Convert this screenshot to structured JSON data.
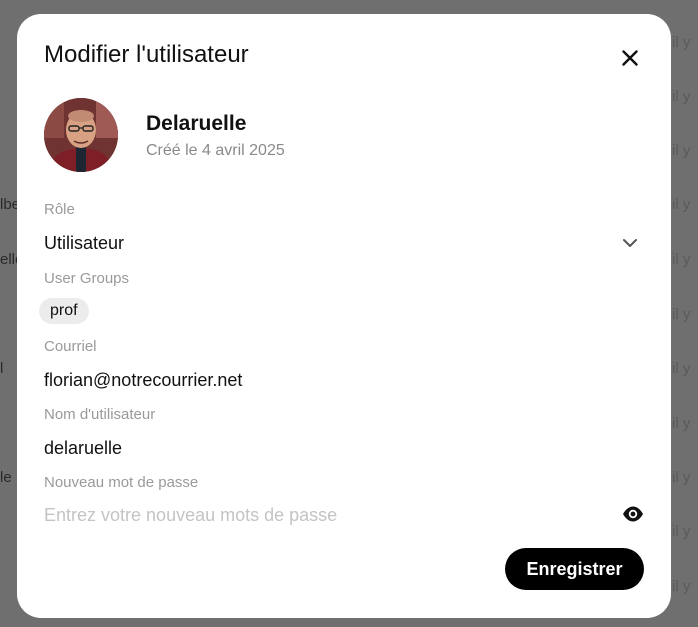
{
  "background": {
    "left_texts": [
      "lbe",
      "elle",
      "l",
      "le"
    ],
    "right_text": "il y"
  },
  "modal": {
    "title": "Modifier l'utilisateur",
    "close_icon": "close-icon",
    "user": {
      "name": "Delaruelle",
      "created": "Créé le 4 avril 2025"
    },
    "role": {
      "label": "Rôle",
      "value": "Utilisateur"
    },
    "groups": {
      "label": "User Groups",
      "items": [
        "prof"
      ]
    },
    "email": {
      "label": "Courriel",
      "value": "florian@notrecourrier.net"
    },
    "username": {
      "label": "Nom d'utilisateur",
      "value": "delaruelle"
    },
    "password": {
      "label": "Nouveau mot de passe",
      "placeholder": "Entrez votre nouveau mots de passe",
      "value": "",
      "toggle_icon": "eye-icon"
    },
    "save_label": "Enregistrer"
  }
}
